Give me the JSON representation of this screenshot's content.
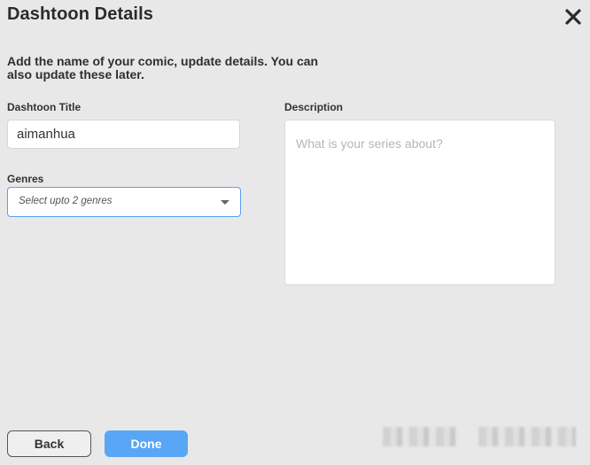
{
  "dialog": {
    "title": "Dashtoon Details",
    "subtitle": "Add the name of your comic, update details. You can also update these later.",
    "close_icon": "close-icon"
  },
  "form": {
    "title_label": "Dashtoon Title",
    "title_value": "aimanhua",
    "genres_label": "Genres",
    "genres_placeholder": "Select upto 2 genres",
    "description_label": "Description",
    "description_placeholder": "What is your series about?"
  },
  "footer": {
    "back_label": "Back",
    "done_label": "Done"
  },
  "colors": {
    "accent": "#58a6f5",
    "background": "#e8e8e8",
    "select_border": "#5b9ff0"
  }
}
